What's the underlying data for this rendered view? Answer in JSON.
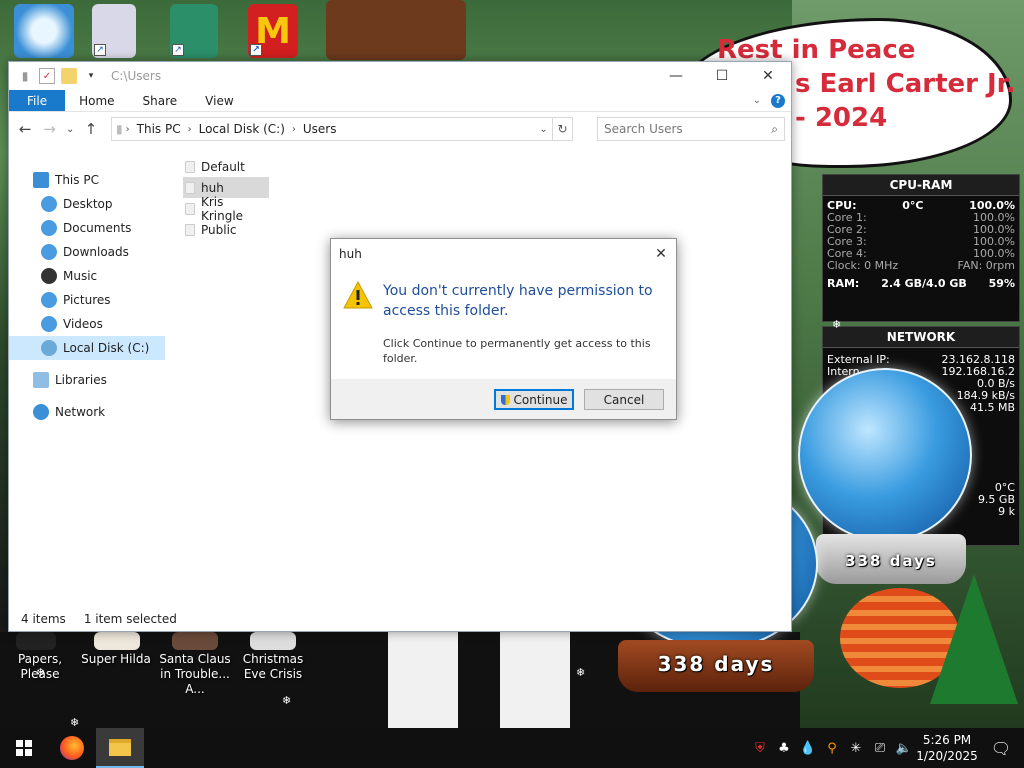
{
  "desktop": {
    "bubble_lines": [
      "Rest in Peace",
      "s Earl Carter Jr.",
      "- 2024"
    ],
    "icons_bottom": [
      {
        "label": "Papers, Please"
      },
      {
        "label": "Super Hilda"
      },
      {
        "label": "Santa Claus in Trouble... A..."
      },
      {
        "label": "Christmas Eve Crisis"
      }
    ],
    "globe_left_days": "338 days",
    "globe_right_days": "338 days",
    "mcdonalds_glyph": "M"
  },
  "gadget_cpu": {
    "title": "CPU-RAM",
    "cpu_label": "CPU:",
    "cpu_temp": "0°C",
    "cpu_pct": "100.0%",
    "cores": [
      {
        "label": "Core 1:",
        "value": "100.0%"
      },
      {
        "label": "Core 2:",
        "value": "100.0%"
      },
      {
        "label": "Core 3:",
        "value": "100.0%"
      },
      {
        "label": "Core 4:",
        "value": "100.0%"
      }
    ],
    "clock_label": "Clock: 0 MHz",
    "fan_label": "FAN: 0rpm",
    "ram_label": "RAM:",
    "ram_value": "2.4 GB/4.0 GB",
    "ram_pct": "59%"
  },
  "gadget_net": {
    "title": "NETWORK",
    "external_label": "External IP:",
    "external_ip": "23.162.8.118",
    "internal_label": "Intern",
    "internal_ip": "192.168.16.2",
    "rate1": "0.0 B/s",
    "rate2": "184.9 kB/s",
    "size": "41.5 MB"
  },
  "gadget_small": {
    "temp": "0°C",
    "mem": "9.5 GB",
    "k": "9 k"
  },
  "explorer": {
    "title": "C:\\Users",
    "tabs": {
      "file": "File",
      "home": "Home",
      "share": "Share",
      "view": "View"
    },
    "breadcrumb": [
      "This PC",
      "Local Disk (C:)",
      "Users"
    ],
    "search_placeholder": "Search Users",
    "nav": {
      "this_pc": "This PC",
      "desktop": "Desktop",
      "documents": "Documents",
      "downloads": "Downloads",
      "music": "Music",
      "pictures": "Pictures",
      "videos": "Videos",
      "local_disk": "Local Disk (C:)",
      "libraries": "Libraries",
      "network": "Network"
    },
    "files": [
      {
        "name": "Default"
      },
      {
        "name": "huh"
      },
      {
        "name": "Kris Kringle"
      },
      {
        "name": "Public"
      }
    ],
    "status_items": "4 items",
    "status_selected": "1 item selected"
  },
  "dialog": {
    "title": "huh",
    "main_text": "You don't currently have permission to access this folder.",
    "sub_text": "Click Continue to permanently get access to this folder.",
    "continue_label": "Continue",
    "cancel_label": "Cancel"
  },
  "taskbar": {
    "time": "5:26 PM",
    "date": "1/20/2025"
  }
}
